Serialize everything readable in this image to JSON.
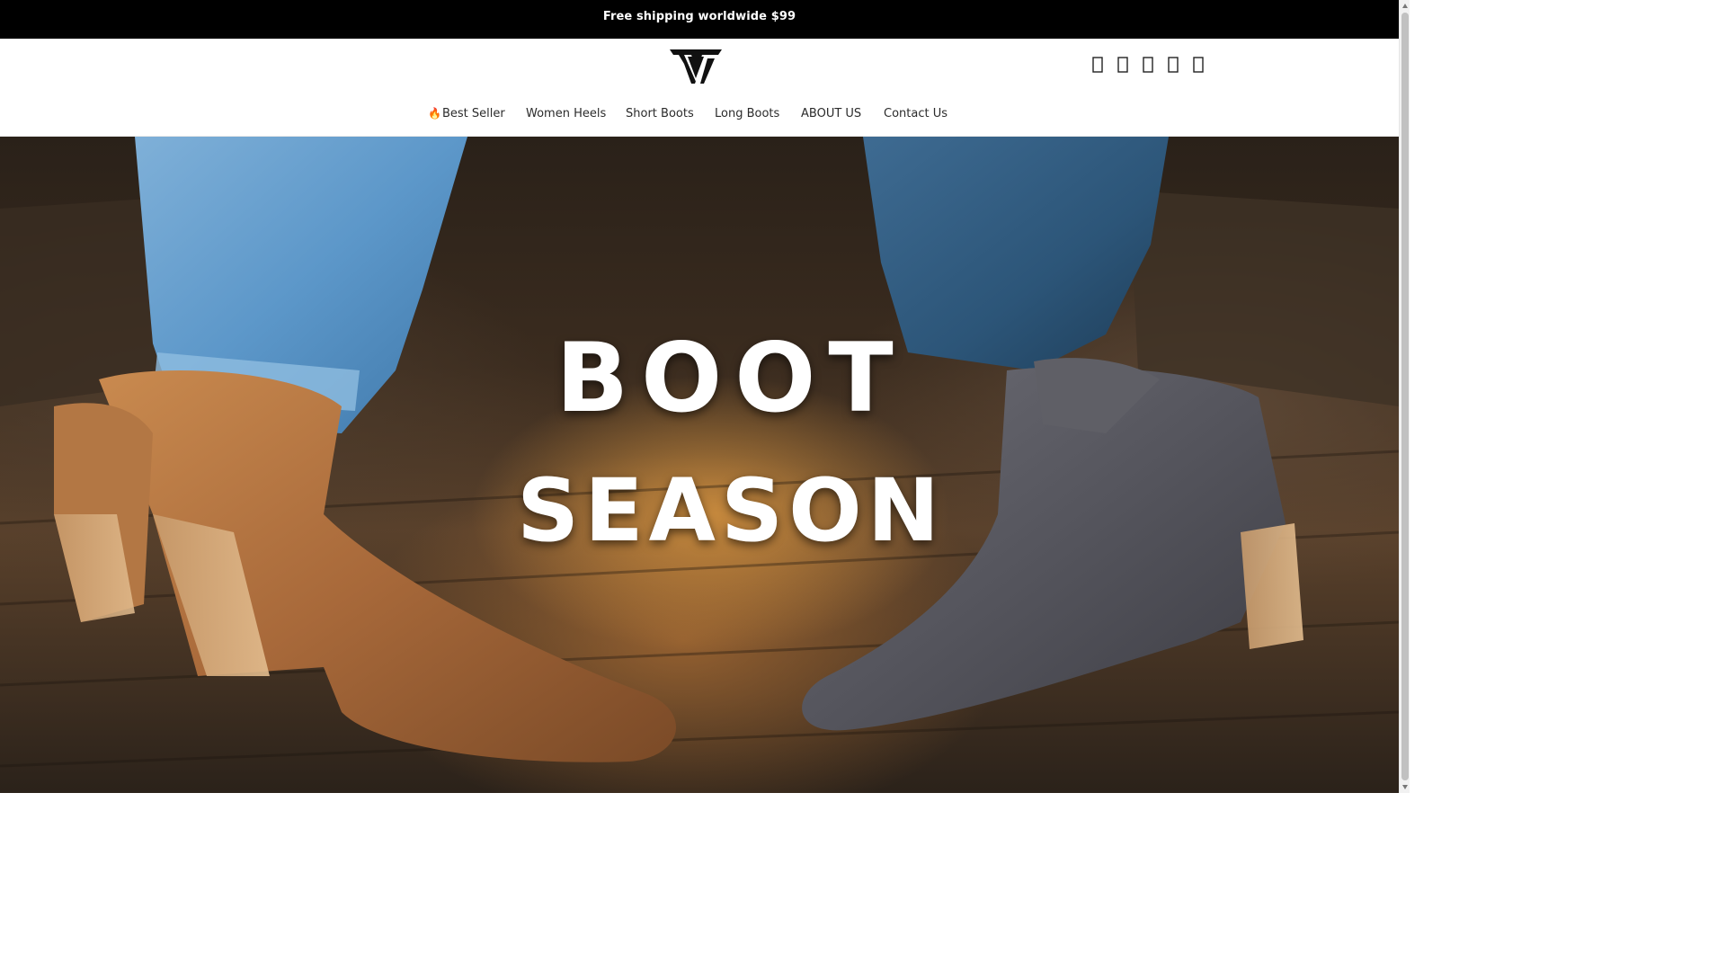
{
  "announcement": {
    "text": "Free shipping worldwide $99"
  },
  "header": {
    "logo_alt": "VT",
    "icons": [
      "search-icon",
      "account-icon",
      "wishlist-icon",
      "currency-icon",
      "cart-icon"
    ]
  },
  "nav": {
    "items": [
      {
        "label": "Best Seller",
        "prefix": "🔥"
      },
      {
        "label": "Women Heels"
      },
      {
        "label": "Short Boots"
      },
      {
        "label": "Long Boots"
      },
      {
        "label": "ABOUT US"
      },
      {
        "label": "Contact Us"
      }
    ]
  },
  "hero": {
    "title_line1": "BOOT",
    "title_line2": "SEASON"
  },
  "colors": {
    "announcement_bg": "#000000",
    "accent_fire": "#e8520f",
    "nav_text": "#2b2b2b"
  }
}
